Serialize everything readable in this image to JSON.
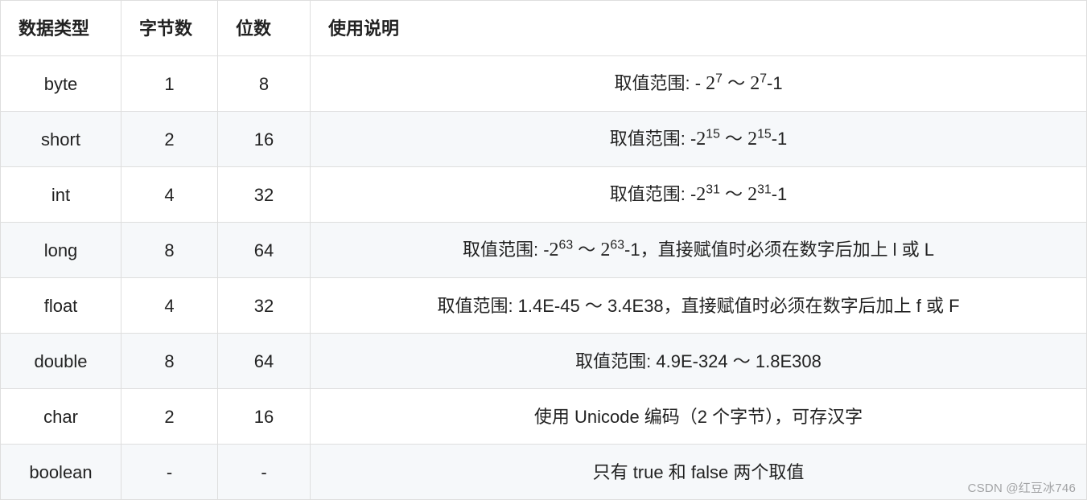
{
  "headers": {
    "data_type": "数据类型",
    "bytes": "字节数",
    "bits": "位数",
    "description": "使用说明"
  },
  "labels": {
    "range_prefix": "取值范围:"
  },
  "rows": [
    {
      "type": "byte",
      "bytes": "1",
      "bits": "8",
      "desc_kind": "pow",
      "neg_prefix": "- ",
      "base1": "2",
      "exp1": "7",
      "sep": " ～ ",
      "base2": "2",
      "exp2": "7",
      "suffix": "-1",
      "extra": ""
    },
    {
      "type": "short",
      "bytes": "2",
      "bits": "16",
      "desc_kind": "pow",
      "neg_prefix": " -",
      "base1": "2",
      "exp1": "15",
      "sep": " ～ ",
      "base2": "2",
      "exp2": "15",
      "suffix": "-1",
      "extra": ""
    },
    {
      "type": "int",
      "bytes": "4",
      "bits": "32",
      "desc_kind": "pow",
      "neg_prefix": " -",
      "base1": "2",
      "exp1": "31",
      "sep": " ～ ",
      "base2": "2",
      "exp2": "31",
      "suffix": "-1",
      "extra": ""
    },
    {
      "type": "long",
      "bytes": "8",
      "bits": "64",
      "desc_kind": "pow",
      "neg_prefix": " -",
      "base1": "2",
      "exp1": "63",
      "sep": " ～ ",
      "base2": "2",
      "exp2": "63",
      "suffix": "-1",
      "extra": "，直接赋值时必须在数字后加上 l 或 L"
    },
    {
      "type": "float",
      "bytes": "4",
      "bits": "32",
      "desc_kind": "text",
      "text": "取值范围: 1.4E-45 ～ 3.4E38，直接赋值时必须在数字后加上 f 或 F"
    },
    {
      "type": "double",
      "bytes": "8",
      "bits": "64",
      "desc_kind": "text",
      "text": "取值范围: 4.9E-324 ～ 1.8E308"
    },
    {
      "type": "char",
      "bytes": "2",
      "bits": "16",
      "desc_kind": "text",
      "text": "使用 Unicode 编码（2 个字节），可存汉字"
    },
    {
      "type": "boolean",
      "bytes": "-",
      "bits": "-",
      "desc_kind": "text",
      "text": "只有 true 和 false 两个取值"
    }
  ],
  "watermark": "CSDN @红豆冰746"
}
